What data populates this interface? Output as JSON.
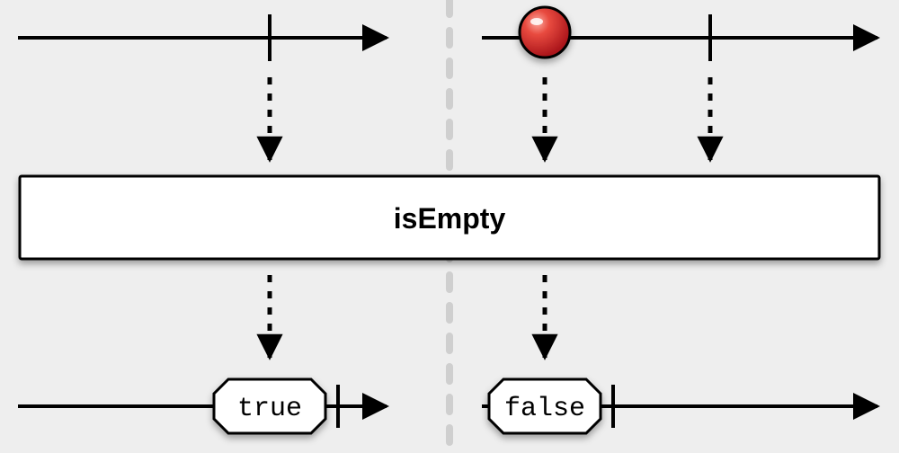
{
  "operator": {
    "name": "isEmpty"
  },
  "results": {
    "left": "true",
    "right": "false"
  },
  "marble": {
    "color": "#d9262a",
    "highlight": "#fc8f77"
  }
}
